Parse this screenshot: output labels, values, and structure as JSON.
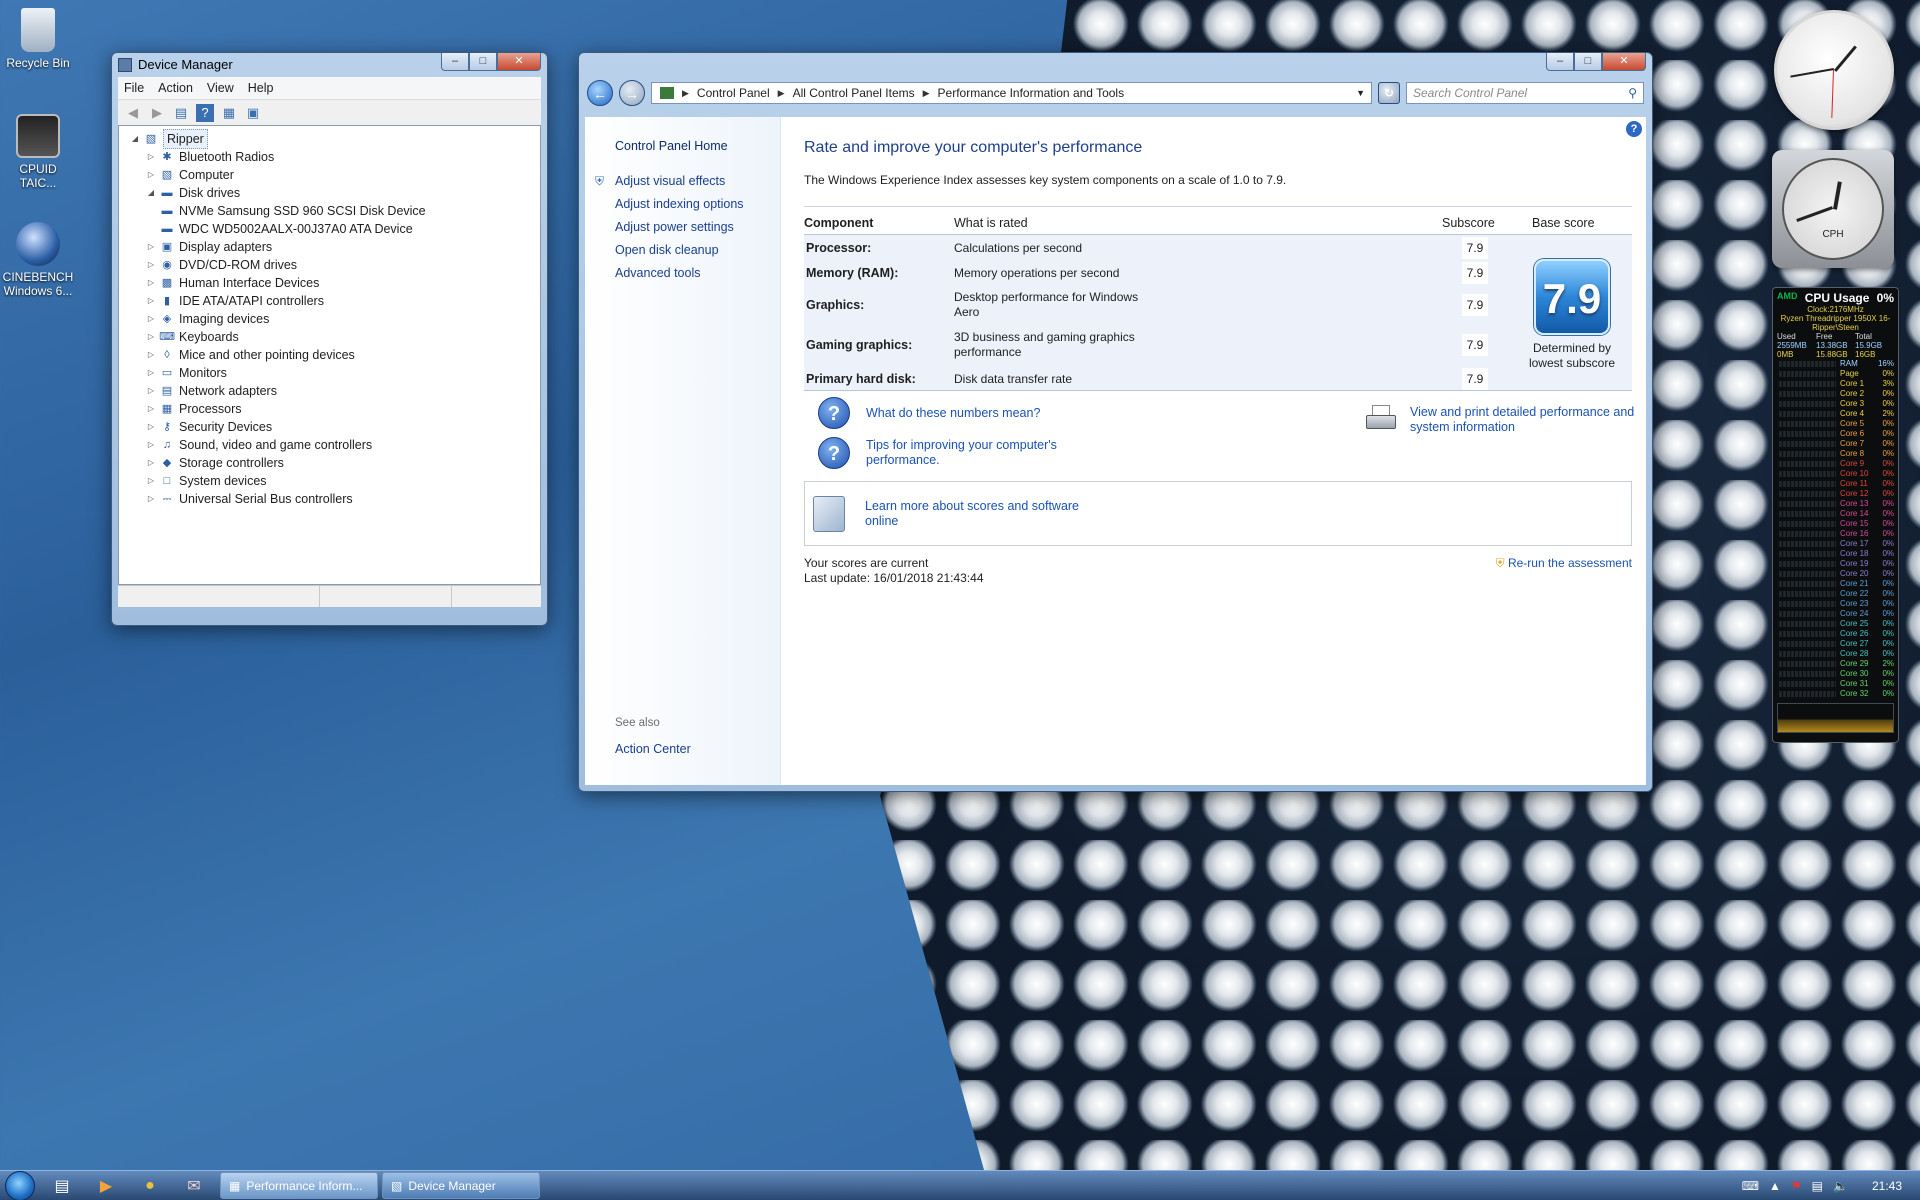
{
  "desktop": {
    "icons": [
      {
        "label": "Recycle Bin"
      },
      {
        "label": "CPUID TAIC..."
      },
      {
        "label": "CINEBENCH Windows 6..."
      }
    ]
  },
  "device_manager": {
    "title": "Device Manager",
    "menu": [
      "File",
      "Action",
      "View",
      "Help"
    ],
    "root": "Ripper",
    "items": [
      {
        "label": "Bluetooth Radios",
        "icon": "bluetooth-icon"
      },
      {
        "label": "Computer",
        "icon": "computer-icon"
      },
      {
        "label": "Disk drives",
        "icon": "disk-icon",
        "expanded": true
      },
      {
        "label": "NVMe Samsung SSD 960 SCSI Disk Device",
        "icon": "disk-icon",
        "child": true
      },
      {
        "label": "WDC WD5002AALX-00J37A0 ATA Device",
        "icon": "disk-icon",
        "child": true
      },
      {
        "label": "Display adapters",
        "icon": "display-icon"
      },
      {
        "label": "DVD/CD-ROM drives",
        "icon": "dvd-icon"
      },
      {
        "label": "Human Interface Devices",
        "icon": "hid-icon"
      },
      {
        "label": "IDE ATA/ATAPI controllers",
        "icon": "ide-icon"
      },
      {
        "label": "Imaging devices",
        "icon": "camera-icon"
      },
      {
        "label": "Keyboards",
        "icon": "keyboard-icon"
      },
      {
        "label": "Mice and other pointing devices",
        "icon": "mouse-icon"
      },
      {
        "label": "Monitors",
        "icon": "monitor-icon"
      },
      {
        "label": "Network adapters",
        "icon": "network-icon"
      },
      {
        "label": "Processors",
        "icon": "processor-icon"
      },
      {
        "label": "Security Devices",
        "icon": "key-icon"
      },
      {
        "label": "Sound, video and game controllers",
        "icon": "speaker-icon"
      },
      {
        "label": "Storage controllers",
        "icon": "storage-icon"
      },
      {
        "label": "System devices",
        "icon": "system-icon"
      },
      {
        "label": "Universal Serial Bus controllers",
        "icon": "usb-icon"
      }
    ]
  },
  "control_panel": {
    "breadcrumb": [
      "Control Panel",
      "All Control Panel Items",
      "Performance Information and Tools"
    ],
    "search_placeholder": "Search Control Panel",
    "sidebar": {
      "home": "Control Panel Home",
      "links": [
        "Adjust visual effects",
        "Adjust indexing options",
        "Adjust power settings",
        "Open disk cleanup",
        "Advanced tools"
      ],
      "see_also_heading": "See also",
      "see_also": [
        "Action Center"
      ]
    },
    "heading": "Rate and improve your computer's performance",
    "description": "The Windows Experience Index assesses key system components on a scale of 1.0 to 7.9.",
    "table": {
      "headers": [
        "Component",
        "What is rated",
        "Subscore",
        "Base score"
      ],
      "rows": [
        {
          "component": "Processor:",
          "rated": "Calculations per second",
          "subscore": "7.9"
        },
        {
          "component": "Memory (RAM):",
          "rated": "Memory operations per second",
          "subscore": "7.9"
        },
        {
          "component": "Graphics:",
          "rated": "Desktop performance for Windows Aero",
          "subscore": "7.9"
        },
        {
          "component": "Gaming graphics:",
          "rated": "3D business and gaming graphics performance",
          "subscore": "7.9"
        },
        {
          "component": "Primary hard disk:",
          "rated": "Disk data transfer rate",
          "subscore": "7.9"
        }
      ],
      "base_score": "7.9",
      "base_caption": "Determined by lowest subscore"
    },
    "help_links": [
      "What do these numbers mean?",
      "Tips for improving your computer's performance."
    ],
    "print_link": "View and print detailed performance and system information",
    "learn_link": "Learn more about scores and software online",
    "status": "Your scores are current",
    "last_update": "Last update: 16/01/2018 21:43:44",
    "rerun": "Re-run the assessment"
  },
  "cpu_gadget": {
    "title": "CPU Usage",
    "total": "0%",
    "vendor": "AMD",
    "clock": "Clock:2176MHz",
    "model": "Ryzen Threadripper 1950X 16-",
    "host": "Ripper\\Steen",
    "mem_headers": [
      "Used",
      "Free",
      "Total"
    ],
    "mem_rows": [
      [
        "2559MB",
        "13.38GB",
        "15.9GB"
      ],
      [
        "0MB",
        "15.88GB",
        "16GB"
      ]
    ],
    "ram_label": "RAM",
    "ram_value": "16%",
    "page_label": "Page",
    "page_value": "0%",
    "cores": [
      {
        "n": "Core 1",
        "v": "3%"
      },
      {
        "n": "Core 2",
        "v": "0%"
      },
      {
        "n": "Core 3",
        "v": "0%"
      },
      {
        "n": "Core 4",
        "v": "2%"
      },
      {
        "n": "Core 5",
        "v": "0%"
      },
      {
        "n": "Core 6",
        "v": "0%"
      },
      {
        "n": "Core 7",
        "v": "0%"
      },
      {
        "n": "Core 8",
        "v": "0%"
      },
      {
        "n": "Core 9",
        "v": "0%"
      },
      {
        "n": "Core 10",
        "v": "0%"
      },
      {
        "n": "Core 11",
        "v": "0%"
      },
      {
        "n": "Core 12",
        "v": "0%"
      },
      {
        "n": "Core 13",
        "v": "0%"
      },
      {
        "n": "Core 14",
        "v": "0%"
      },
      {
        "n": "Core 15",
        "v": "0%"
      },
      {
        "n": "Core 16",
        "v": "0%"
      },
      {
        "n": "Core 17",
        "v": "0%"
      },
      {
        "n": "Core 18",
        "v": "0%"
      },
      {
        "n": "Core 19",
        "v": "0%"
      },
      {
        "n": "Core 20",
        "v": "0%"
      },
      {
        "n": "Core 21",
        "v": "0%"
      },
      {
        "n": "Core 22",
        "v": "0%"
      },
      {
        "n": "Core 23",
        "v": "0%"
      },
      {
        "n": "Core 24",
        "v": "0%"
      },
      {
        "n": "Core 25",
        "v": "0%"
      },
      {
        "n": "Core 26",
        "v": "0%"
      },
      {
        "n": "Core 27",
        "v": "0%"
      },
      {
        "n": "Core 28",
        "v": "0%"
      },
      {
        "n": "Core 29",
        "v": "2%"
      },
      {
        "n": "Core 30",
        "v": "0%"
      },
      {
        "n": "Core 31",
        "v": "0%"
      },
      {
        "n": "Core 32",
        "v": "0%"
      }
    ],
    "core_colors": [
      "#f2d13b",
      "#f0a23c",
      "#e0483c",
      "#d84a9a",
      "#8a7fd0",
      "#5f9fd6",
      "#4cc3c3",
      "#67d46a",
      "#c2de4a"
    ]
  },
  "clock_gadget": {
    "label": "CPH"
  },
  "taskbar": {
    "items": [
      "Performance Inform...",
      "Device Manager"
    ],
    "time": "21:43"
  }
}
